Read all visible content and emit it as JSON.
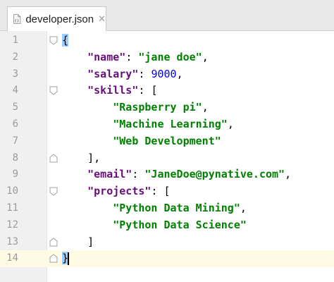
{
  "tab": {
    "title": "developer.json",
    "close_glyph": "✕",
    "icon": "json-file-icon"
  },
  "colors": {
    "key": "#660e7a",
    "string": "#008000",
    "number": "#0000ff",
    "brace_highlight": "#99ccff",
    "current_line": "#fffae3"
  },
  "editor": {
    "lines": [
      {
        "n": "1",
        "open": "{",
        "fold": "open"
      },
      {
        "n": "2",
        "indent": "    ",
        "key": "\"name\"",
        "sep": ": ",
        "val": "\"jane doe\"",
        "vtype": "str",
        "tail": ","
      },
      {
        "n": "3",
        "indent": "    ",
        "key": "\"salary\"",
        "sep": ": ",
        "val": "9000",
        "vtype": "num",
        "tail": ","
      },
      {
        "n": "4",
        "indent": "    ",
        "key": "\"skills\"",
        "sep": ": ",
        "tail": "[",
        "fold": "open"
      },
      {
        "n": "5",
        "indent": "        ",
        "val": "\"Raspberry pi\"",
        "vtype": "str",
        "tail": ","
      },
      {
        "n": "6",
        "indent": "        ",
        "val": "\"Machine Learning\"",
        "vtype": "str",
        "tail": ","
      },
      {
        "n": "7",
        "indent": "        ",
        "val": "\"Web Development\"",
        "vtype": "str",
        "tail": ""
      },
      {
        "n": "8",
        "indent": "    ",
        "tail": "],",
        "fold": "close"
      },
      {
        "n": "9",
        "indent": "    ",
        "key": "\"email\"",
        "sep": ": ",
        "val": "\"JaneDoe@pynative.com\"",
        "vtype": "str",
        "tail": ","
      },
      {
        "n": "10",
        "indent": "    ",
        "key": "\"projects\"",
        "sep": ": ",
        "tail": "[",
        "fold": "open"
      },
      {
        "n": "11",
        "indent": "        ",
        "val": "\"Python Data Mining\"",
        "vtype": "str",
        "tail": ","
      },
      {
        "n": "12",
        "indent": "        ",
        "val": "\"Python Data Science\"",
        "vtype": "str",
        "tail": ""
      },
      {
        "n": "13",
        "indent": "    ",
        "tail": "]",
        "fold": "close"
      },
      {
        "n": "14",
        "open": "}",
        "fold": "close",
        "current": true
      }
    ]
  }
}
